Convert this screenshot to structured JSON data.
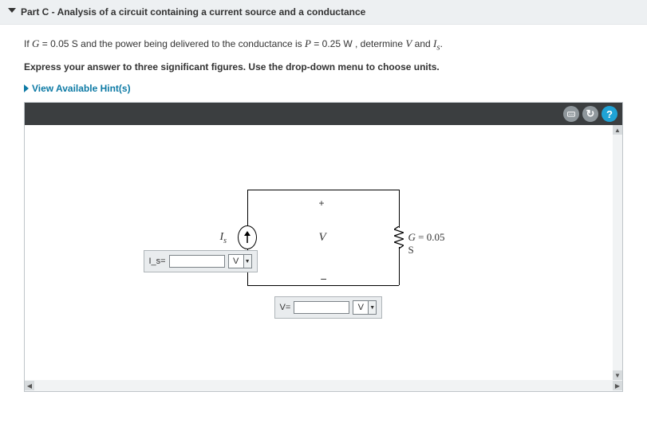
{
  "header": {
    "part_label": "Part C",
    "title_suffix": " - Analysis of a circuit containing a current source and a conductance"
  },
  "prompt": {
    "prefix": "If ",
    "G_var": "G",
    "eq1": " =  0.05 S",
    "mid": " and the power being delivered to the conductance is ",
    "P_var": "P",
    "eq2": " =  0.25 W",
    "suffix1": ", determine ",
    "V_var": "V",
    "and": " and ",
    "Is_var": "I",
    "Is_sub": "s",
    "period": ".",
    "line2": "Express your answer to three significant figures. Use the drop-down menu to choose units."
  },
  "hints": {
    "label": "View Available Hint(s)"
  },
  "toolbar": {
    "hint_icon": "⍟",
    "reset_icon": "↻",
    "help_icon": "?"
  },
  "circuit": {
    "Is_label_I": "I",
    "Is_label_s": "s",
    "V_label": "V",
    "plus": "+",
    "minus": "−",
    "G_var": "G",
    "G_value": "  = 0.05 S"
  },
  "inputs": {
    "is": {
      "label": "I_s=",
      "value": "",
      "unit": "V"
    },
    "v": {
      "label": "V=",
      "value": "",
      "unit": "V"
    }
  },
  "scroll": {
    "up": "▲",
    "down": "▼",
    "left": "◀",
    "right": "▶"
  }
}
